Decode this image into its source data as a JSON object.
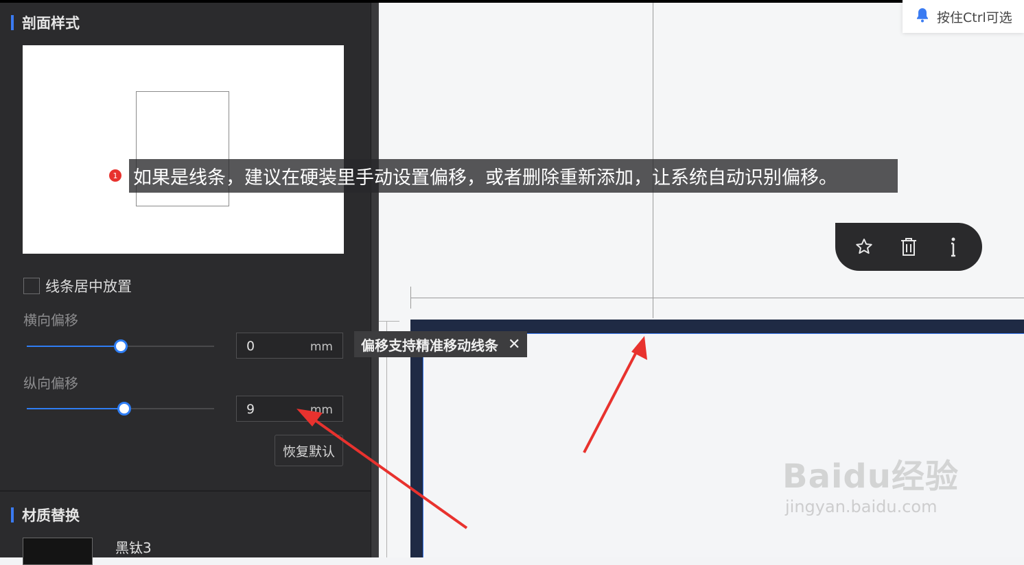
{
  "left_panel": {
    "section_profile_title": "剖面样式",
    "center_line_label": "线条居中放置",
    "horizontal_offset": {
      "label": "横向偏移",
      "value": "0",
      "unit": "mm",
      "slider_fraction": 0.5
    },
    "vertical_offset": {
      "label": "纵向偏移",
      "value": "9",
      "unit": "mm",
      "slider_fraction": 0.52
    },
    "reset_label": "恢复默认",
    "material_title": "材质替换",
    "material_name": "黑钛3"
  },
  "canvas": {
    "notification_text": "按住Ctrl可选",
    "tooltip_text": "偏移支持精准移动线条",
    "toolbar_icons": [
      "star-icon",
      "trash-icon",
      "info-icon"
    ]
  },
  "annotation": {
    "marker": "1",
    "text": "如果是线条，建议在硬装里手动设置偏移，或者删除重新添加，让系统自动识别偏移。"
  },
  "watermark": {
    "main": "Baidu经验",
    "sub": "jingyan.baidu.com"
  },
  "colors": {
    "accent": "#3a7bf2",
    "panel_bg": "#2b2b2d",
    "arrow": "#e8322e"
  }
}
